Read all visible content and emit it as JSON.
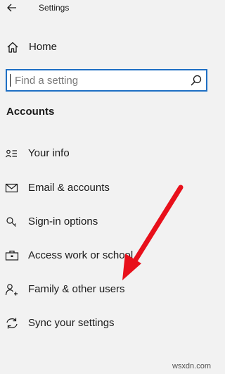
{
  "window": {
    "title": "Settings",
    "back_icon": "back-arrow-icon"
  },
  "home": {
    "label": "Home",
    "icon": "home-icon"
  },
  "search": {
    "placeholder": "Find a setting",
    "icon": "search-icon",
    "accent_color": "#1e6fc4"
  },
  "section": {
    "heading": "Accounts"
  },
  "nav_items": [
    {
      "label": "Your info",
      "icon": "contact-card-icon"
    },
    {
      "label": "Email & accounts",
      "icon": "mail-icon"
    },
    {
      "label": "Sign-in options",
      "icon": "key-icon"
    },
    {
      "label": "Access work or school",
      "icon": "briefcase-icon"
    },
    {
      "label": "Family & other users",
      "icon": "person-add-icon"
    },
    {
      "label": "Sync your settings",
      "icon": "sync-icon"
    }
  ],
  "annotation": {
    "arrow_color": "#e8101b",
    "points_to": "Family & other users"
  },
  "watermark": "wsxdn.com"
}
